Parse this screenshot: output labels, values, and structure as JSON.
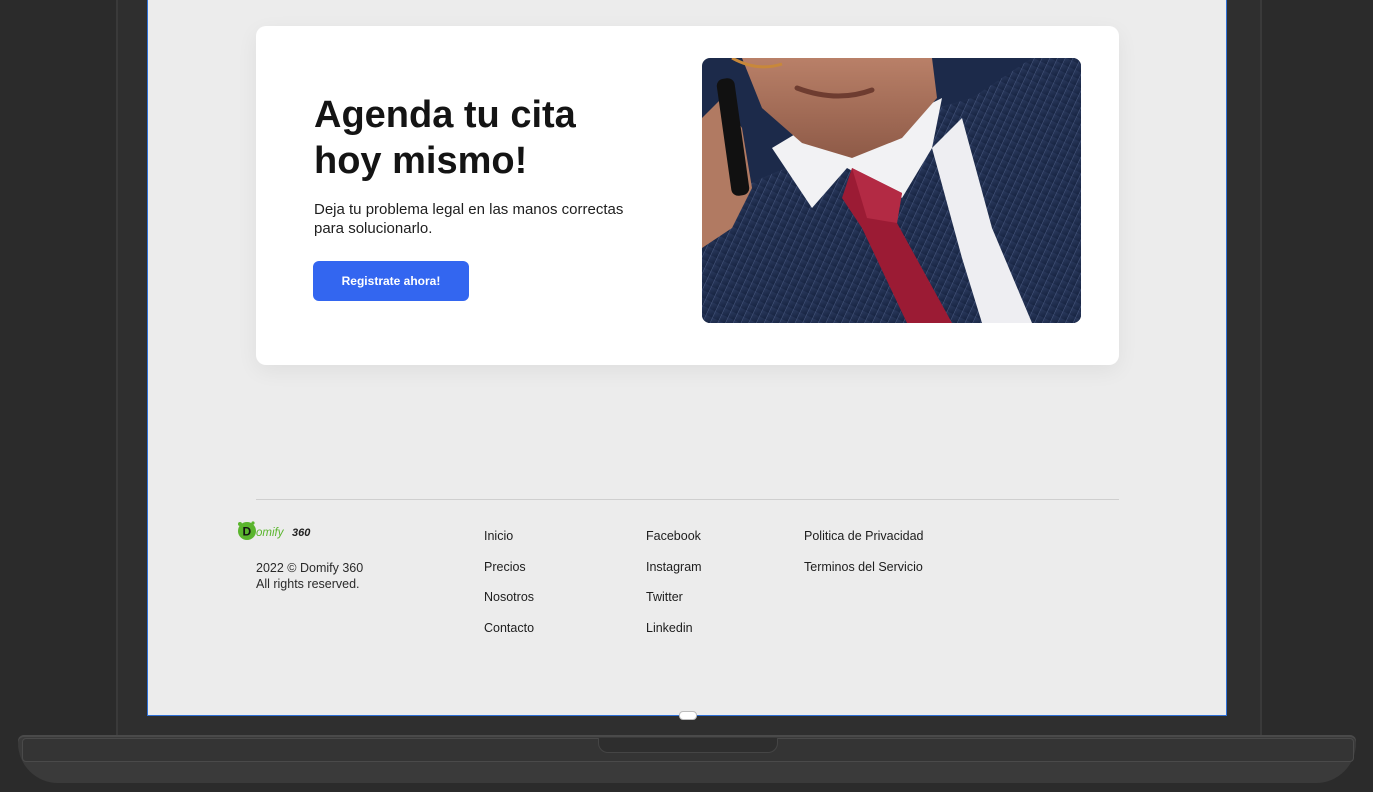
{
  "cta": {
    "title": "Agenda tu cita hoy mismo!",
    "description": "Deja tu problema legal en las manos correctas para solucionarlo.",
    "button_label": "Registrate ahora!",
    "image_icon": "businessman-on-phone-photo"
  },
  "footer": {
    "logo_text": "Domify 360",
    "copyright_line1": "2022 © Domify 360",
    "copyright_line2": "All rights reserved.",
    "nav_links": [
      "Inicio",
      "Precios",
      "Nosotros",
      "Contacto"
    ],
    "social_links": [
      "Facebook",
      "Instagram",
      "Twitter",
      "Linkedin"
    ],
    "legal_links": [
      "Politica de Privacidad",
      "Terminos del Servicio"
    ]
  },
  "colors": {
    "accent": "#3366f0",
    "page_background": "#ececec",
    "frame": "#2b2b2b"
  }
}
